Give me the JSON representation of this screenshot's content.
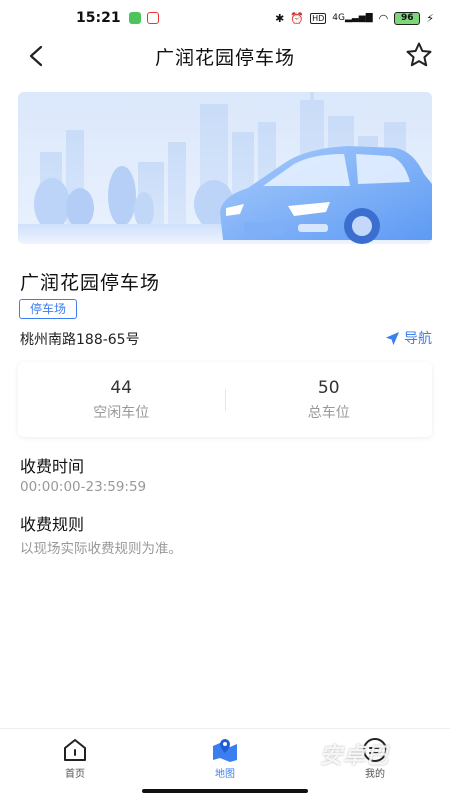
{
  "status_bar": {
    "time": "15:21",
    "network": "4G",
    "hd": "HD",
    "battery": "96"
  },
  "header": {
    "title": "广润花园停车场",
    "back_icon": "chevron-left-icon",
    "favorite_icon": "star-outline-icon"
  },
  "parking": {
    "name": "广润花园停车场",
    "tag": "停车场",
    "address": "桃州南路188-65号",
    "navigate_label": "导航"
  },
  "stats": {
    "free_count": "44",
    "free_label": "空闲车位",
    "total_count": "50",
    "total_label": "总车位"
  },
  "fee_time": {
    "heading": "收费时间",
    "value": "00:00:00-23:59:59"
  },
  "fee_rules": {
    "heading": "收费规则",
    "value": "以现场实际收费规则为准。"
  },
  "tab_bar": {
    "tabs": [
      {
        "label": "首页",
        "icon": "home-icon",
        "active": false
      },
      {
        "label": "地图",
        "icon": "map-icon",
        "active": true
      },
      {
        "label": "我的",
        "icon": "profile-icon",
        "active": false
      }
    ]
  },
  "watermark": "安卓巴",
  "colors": {
    "accent": "#3b7ef0",
    "text_primary": "#111111",
    "text_secondary": "#999999"
  }
}
